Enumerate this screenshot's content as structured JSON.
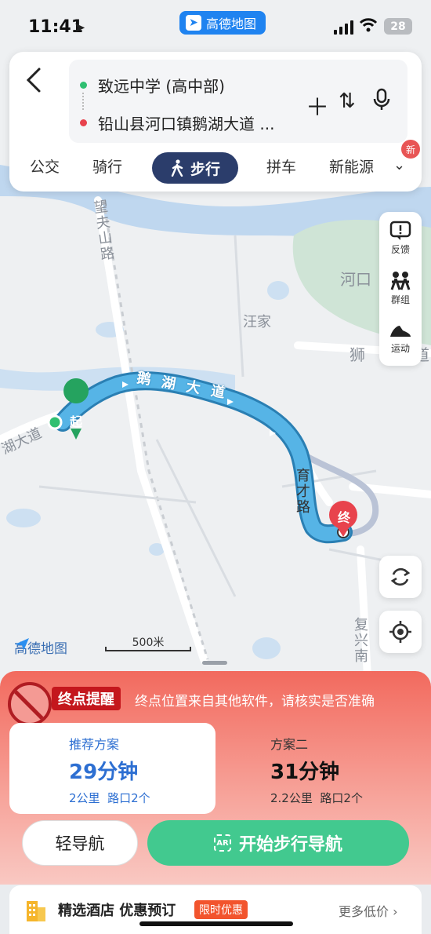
{
  "status": {
    "time": "11:41",
    "app_name": "高德地图",
    "battery": "28"
  },
  "route": {
    "origin": "致远中学 (高中部)",
    "destination": "铅山县河口镇鹅湖大道 ...",
    "modes": [
      "公交",
      "骑行",
      "步行",
      "拼车",
      "新能源"
    ],
    "active_mode": "步行",
    "new_badge": "新"
  },
  "map": {
    "labels": {
      "wangjia": "汪家",
      "hekou": "河口",
      "shizi": "狮",
      "shizi_road": "道",
      "ehu_left": "湖大道"
    },
    "roads_vertical": {
      "wangfushan": "望夫山路",
      "yucai": "育才路",
      "fuxing": "复兴南"
    },
    "route_road": "鹅湖大道",
    "start_marker": "起",
    "end_marker": "终",
    "logo": "高德地图",
    "scale": "500米"
  },
  "tools": {
    "feedback": "反馈",
    "group": "群组",
    "sport": "运动"
  },
  "alert": {
    "tag": "终点提醒",
    "message": "终点位置来自其他软件，请核实是否准确"
  },
  "plans": [
    {
      "name": "推荐方案",
      "duration": "29分钟",
      "distance": "2公里",
      "crossings": "路口2个"
    },
    {
      "name": "方案二",
      "duration": "31分钟",
      "distance": "2.2公里",
      "crossings": "路口2个"
    }
  ],
  "buttons": {
    "light_nav": "轻导航",
    "start_nav": "开始步行导航",
    "ar": "AR"
  },
  "hotel": {
    "title": "精选酒店 优惠预订",
    "badge": "限时优惠",
    "more": "更多低价 ›"
  },
  "colors": {
    "route": "#56b4e6",
    "active_mode": "#2b3d6b",
    "start_btn": "#42c98f",
    "alert": "#f26a5e"
  }
}
